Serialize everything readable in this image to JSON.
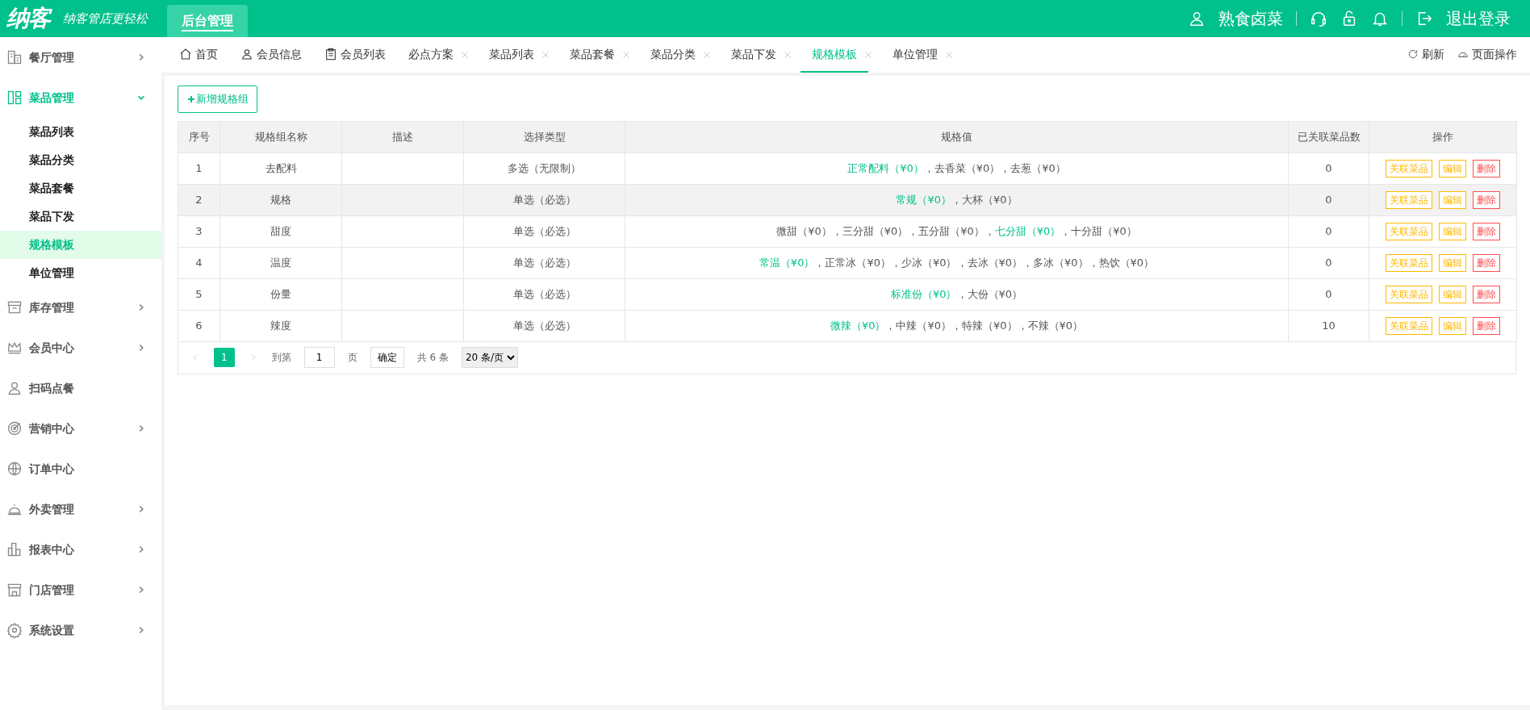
{
  "header": {
    "logo": "纳客",
    "slogan": "纳客管店更轻松",
    "module_tab": "后台管理",
    "user": "熟食卤菜",
    "logout": "退出登录"
  },
  "sidebar": {
    "items": [
      {
        "label": "餐厅管理",
        "expanded": false,
        "has_arrow": true
      },
      {
        "label": "菜品管理",
        "expanded": true,
        "has_arrow": true,
        "children": [
          {
            "label": "菜品列表",
            "selected": false
          },
          {
            "label": "菜品分类",
            "selected": false
          },
          {
            "label": "菜品套餐",
            "selected": false
          },
          {
            "label": "菜品下发",
            "selected": false
          },
          {
            "label": "规格模板",
            "selected": true
          },
          {
            "label": "单位管理",
            "selected": false
          }
        ]
      },
      {
        "label": "库存管理",
        "expanded": false,
        "has_arrow": true
      },
      {
        "label": "会员中心",
        "expanded": false,
        "has_arrow": true
      },
      {
        "label": "扫码点餐",
        "expanded": false,
        "has_arrow": false
      },
      {
        "label": "营销中心",
        "expanded": false,
        "has_arrow": true
      },
      {
        "label": "订单中心",
        "expanded": false,
        "has_arrow": false
      },
      {
        "label": "外卖管理",
        "expanded": false,
        "has_arrow": true
      },
      {
        "label": "报表中心",
        "expanded": false,
        "has_arrow": true
      },
      {
        "label": "门店管理",
        "expanded": false,
        "has_arrow": true
      },
      {
        "label": "系统设置",
        "expanded": false,
        "has_arrow": true
      }
    ]
  },
  "tabs": [
    {
      "label": "首页",
      "closable": false,
      "selected": false
    },
    {
      "label": "会员信息",
      "closable": false,
      "selected": false
    },
    {
      "label": "会员列表",
      "closable": false,
      "selected": false
    },
    {
      "label": "必点方案",
      "closable": true,
      "selected": false
    },
    {
      "label": "菜品列表",
      "closable": true,
      "selected": false
    },
    {
      "label": "菜品套餐",
      "closable": true,
      "selected": false
    },
    {
      "label": "菜品分类",
      "closable": true,
      "selected": false
    },
    {
      "label": "菜品下发",
      "closable": true,
      "selected": false
    },
    {
      "label": "规格模板",
      "closable": true,
      "selected": true
    },
    {
      "label": "单位管理",
      "closable": true,
      "selected": false
    }
  ],
  "tab_actions": [
    "刷新",
    "页面操作"
  ],
  "add_button": "新增规格组",
  "table": {
    "columns": [
      "序号",
      "规格组名称",
      "描述",
      "选择类型",
      "规格值",
      "已关联菜品数",
      "操作"
    ],
    "rows": [
      {
        "no": "1",
        "name": "去配料",
        "type": "多选（无限制）",
        "values": [
          {
            "text": "正常配料（¥0）",
            "default": true
          },
          {
            "text": "，去香菜（¥0）",
            "default": false
          },
          {
            "text": "，去葱（¥0）",
            "default": false
          }
        ],
        "count": "0",
        "selected": false,
        "actions": [
          {
            "label": "关联菜品",
            "kind": "warning"
          },
          {
            "label": "编辑",
            "kind": "warning"
          },
          {
            "label": "删除",
            "kind": "danger"
          }
        ]
      },
      {
        "no": "2",
        "name": "规格",
        "type": "单选（必选）",
        "values": [
          {
            "text": "常规（¥0）",
            "default": true
          },
          {
            "text": "，大杯（¥0）",
            "default": false
          }
        ],
        "count": "0",
        "selected": true,
        "actions": [
          {
            "label": "关联菜品",
            "kind": "warning"
          },
          {
            "label": "编辑",
            "kind": "warning"
          },
          {
            "label": "删除",
            "kind": "danger"
          }
        ]
      },
      {
        "no": "3",
        "name": "甜度",
        "type": "单选（必选）",
        "values": [
          {
            "text": "微甜（¥0）",
            "default": false
          },
          {
            "text": "，三分甜（¥0）",
            "default": false
          },
          {
            "text": "，五分甜（¥0），",
            "default": false
          },
          {
            "text": "七分甜（¥0）",
            "default": true
          },
          {
            "text": "，十分甜（¥0）",
            "default": false
          }
        ],
        "count": "0",
        "selected": false,
        "actions": [
          {
            "label": "关联菜品",
            "kind": "warning"
          },
          {
            "label": "编辑",
            "kind": "warning"
          },
          {
            "label": "删除",
            "kind": "danger"
          }
        ]
      },
      {
        "no": "4",
        "name": "温度",
        "type": "单选（必选）",
        "values": [
          {
            "text": "常温（¥0）",
            "default": true
          },
          {
            "text": "，正常冰（¥0）",
            "default": false
          },
          {
            "text": "，少冰（¥0）",
            "default": false
          },
          {
            "text": "，去冰（¥0）",
            "default": false
          },
          {
            "text": "，多冰（¥0）",
            "default": false
          },
          {
            "text": "，热饮（¥0）",
            "default": false
          }
        ],
        "count": "0",
        "selected": false,
        "actions": [
          {
            "label": "关联菜品",
            "kind": "warning"
          },
          {
            "label": "编辑",
            "kind": "warning"
          },
          {
            "label": "删除",
            "kind": "danger"
          }
        ]
      },
      {
        "no": "5",
        "name": "份量",
        "type": "单选（必选）",
        "values": [
          {
            "text": "标准份（¥0）",
            "default": true
          },
          {
            "text": "，大份（¥0）",
            "default": false
          }
        ],
        "count": "0",
        "selected": false,
        "actions": [
          {
            "label": "关联菜品",
            "kind": "warning"
          },
          {
            "label": "编辑",
            "kind": "warning"
          },
          {
            "label": "删除",
            "kind": "danger"
          }
        ]
      },
      {
        "no": "6",
        "name": "辣度",
        "type": "单选（必选）",
        "values": [
          {
            "text": "微辣（¥0）",
            "default": true
          },
          {
            "text": "，中辣（¥0）",
            "default": false
          },
          {
            "text": "，特辣（¥0）",
            "default": false
          },
          {
            "text": "，不辣（¥0）",
            "default": false
          }
        ],
        "count": "10",
        "selected": false,
        "actions": [
          {
            "label": "关联菜品",
            "kind": "warning"
          },
          {
            "label": "编辑",
            "kind": "warning"
          },
          {
            "label": "删除",
            "kind": "danger"
          }
        ]
      }
    ]
  },
  "pagination": {
    "current": "1",
    "goto_label": "到第",
    "page_value": "1",
    "page_unit": "页",
    "confirm": "确定",
    "total": "共 6 条",
    "page_size": "20 条/页"
  }
}
